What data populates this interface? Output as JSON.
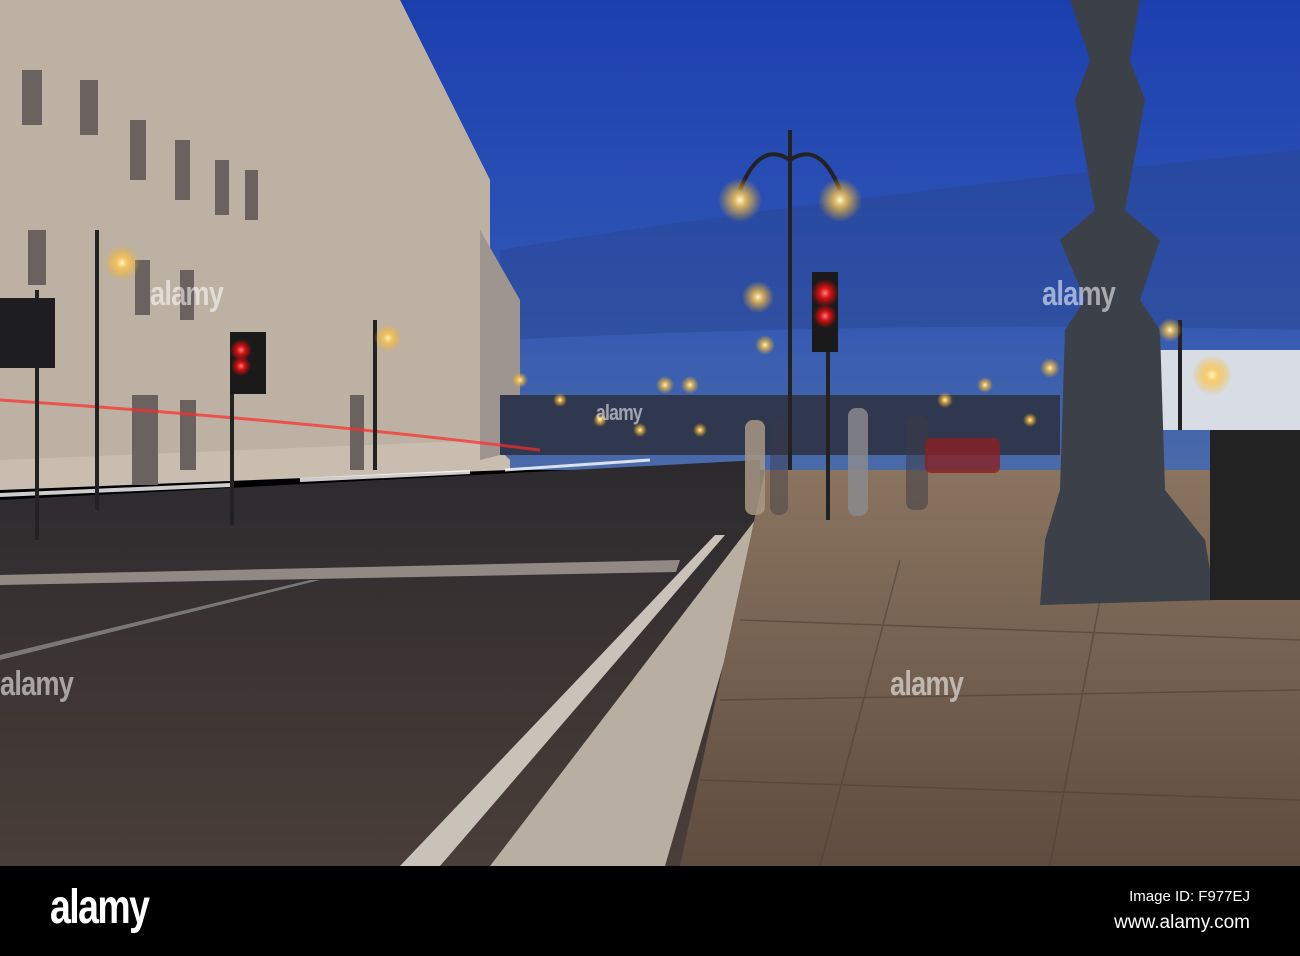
{
  "photo": {
    "subject": "Trieste street at dusk with lamp posts and traffic lights"
  },
  "watermark": {
    "text": "alamy"
  },
  "footer": {
    "logo": "alamy",
    "image_id": "Image ID: F977EJ",
    "website": "www.alamy.com"
  },
  "colors": {
    "sky_top": "#1f47b8",
    "sky_bottom": "#3a5fb0",
    "road": "#3a3634",
    "pavement": "#6e5a48",
    "lamp": "#ffd27a",
    "red_light": "#ff2020"
  }
}
